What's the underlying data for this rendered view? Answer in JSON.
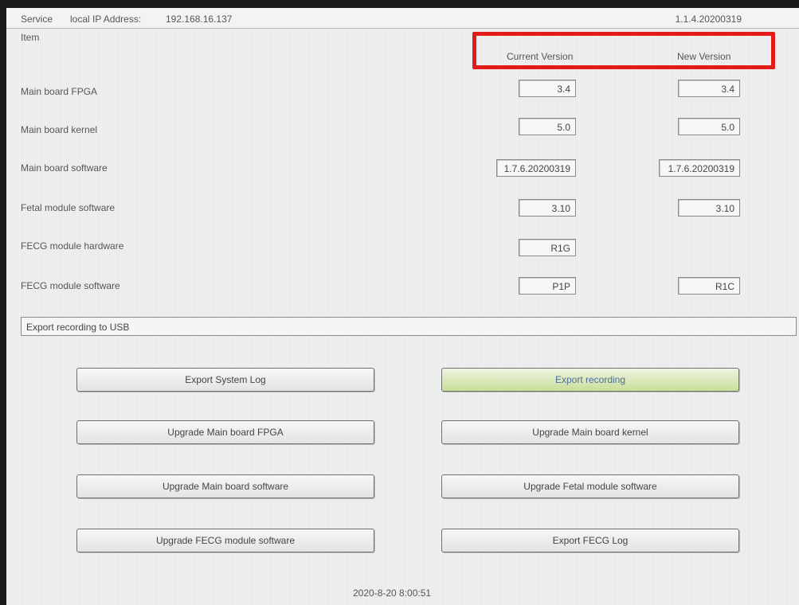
{
  "topbar": {
    "service_label": "Service",
    "ip_label": "local IP Address:",
    "ip_value": "192.168.16.137",
    "app_version": "1.1.4.20200319"
  },
  "table": {
    "item_header": "Item",
    "current_header": "Current Version",
    "new_header": "New Version",
    "rows": [
      {
        "label": "Main board FPGA",
        "current": "3.4",
        "new": "3.4"
      },
      {
        "label": "Main board kernel",
        "current": "5.0",
        "new": "5.0"
      },
      {
        "label": "Main board software",
        "current": "1.7.6.20200319",
        "new": "1.7.6.20200319"
      },
      {
        "label": "Fetal module software",
        "current": "3.10",
        "new": "3.10"
      },
      {
        "label": "FECG module hardware",
        "current": "R1G",
        "new": ""
      },
      {
        "label": "FECG module software",
        "current": "P1P",
        "new": "R1C"
      }
    ]
  },
  "section": {
    "title": "Export recording to USB"
  },
  "buttons": {
    "export_system_log": "Export System Log",
    "export_recording": "Export recording",
    "upgrade_fpga": "Upgrade Main board FPGA",
    "upgrade_kernel": "Upgrade Main board kernel",
    "upgrade_software": "Upgrade Main board software",
    "upgrade_fetal": "Upgrade Fetal module software",
    "upgrade_fecg": "Upgrade FECG module software",
    "export_fecg_log": "Export FECG Log"
  },
  "status": {
    "datetime": "2020-8-20 8:00:51"
  },
  "colors": {
    "highlight": "#e21b1b",
    "selected_button": "#c9de98"
  }
}
